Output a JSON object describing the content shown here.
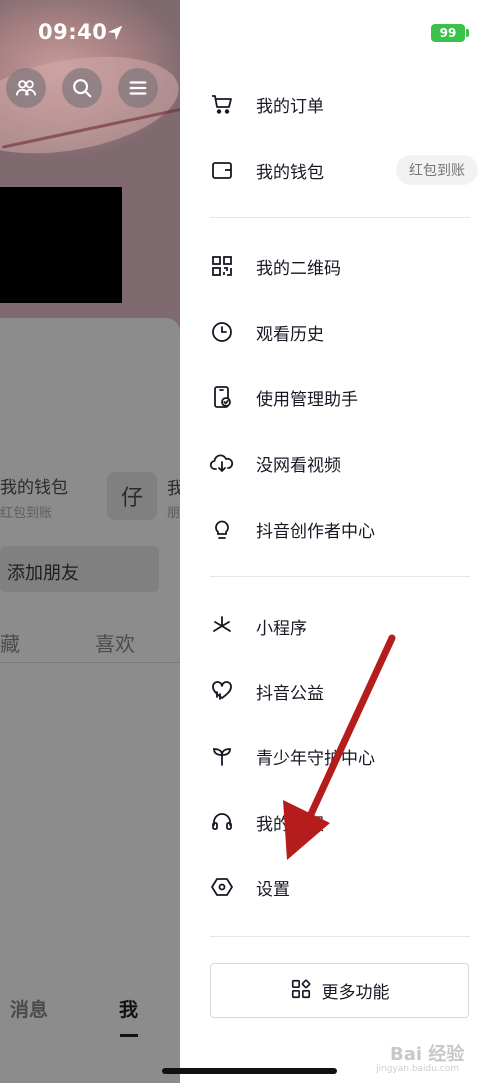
{
  "status_bar": {
    "time": "09:40",
    "battery": "99"
  },
  "profile_bg": {
    "wallet_title": "我的钱包",
    "wallet_sub": "红包到账",
    "wallet_icon_glyph": "仔",
    "right_frag_title": "我",
    "right_frag_sub": "朋",
    "add_friend": "添加朋友",
    "tab_fragment": "藏",
    "tab_like": "喜欢",
    "bottom_messages": "消息",
    "bottom_me": "我"
  },
  "drawer": {
    "items": [
      {
        "label": "我的订单",
        "icon": "cart-icon"
      },
      {
        "label": "我的钱包",
        "icon": "wallet-icon",
        "badge": "红包到账"
      },
      {
        "label": "我的二维码",
        "icon": "qrcode-icon"
      },
      {
        "label": "观看历史",
        "icon": "clock-icon"
      },
      {
        "label": "使用管理助手",
        "icon": "phone-check-icon"
      },
      {
        "label": "没网看视频",
        "icon": "cloud-download-icon"
      },
      {
        "label": "抖音创作者中心",
        "icon": "bulb-icon"
      },
      {
        "label": "小程序",
        "icon": "asterisk-icon"
      },
      {
        "label": "抖音公益",
        "icon": "heart-hands-icon"
      },
      {
        "label": "青少年守护中心",
        "icon": "sprout-icon"
      },
      {
        "label": "我的客服",
        "icon": "headset-icon"
      },
      {
        "label": "设置",
        "icon": "hexagon-gear-icon"
      }
    ],
    "more_button": "更多功能"
  },
  "watermark": {
    "text": "Bai 经验",
    "url": "jingyan.baidu.com"
  },
  "colors": {
    "annotation_arrow": "#b51d1d",
    "battery": "#3ac24b"
  }
}
